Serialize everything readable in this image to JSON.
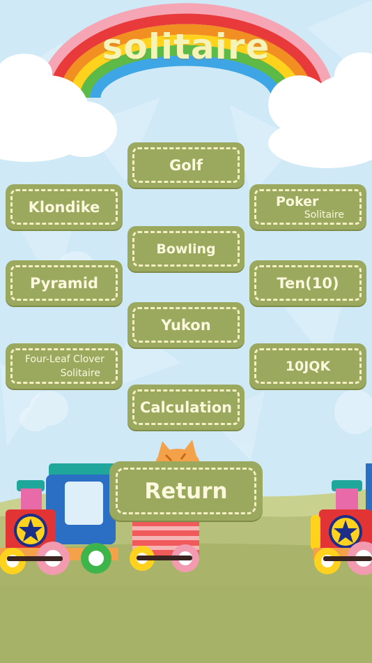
{
  "app": {
    "title": "solitaire"
  },
  "menu": {
    "golf": "Golf",
    "klondike": "Klondike",
    "poker": {
      "line1": "Poker",
      "line2": "Solitaire"
    },
    "bowling": "Bowling",
    "pyramid": "Pyramid",
    "ten": "Ten(10)",
    "yukon": "Yukon",
    "four_leaf": {
      "line1": "Four-Leaf Clover",
      "line2": "Solitaire"
    },
    "tenjqk": "10JQK",
    "calculation": "Calculation"
  },
  "footer": {
    "return_label": "Return"
  },
  "colors": {
    "button_fill": "#9aa95e",
    "button_dash": "#f4f0c4",
    "button_text": "#fbf8dd",
    "sky": "#cfe9f7",
    "ground": "#b3bd72",
    "title_text": "#f6f3b8"
  }
}
